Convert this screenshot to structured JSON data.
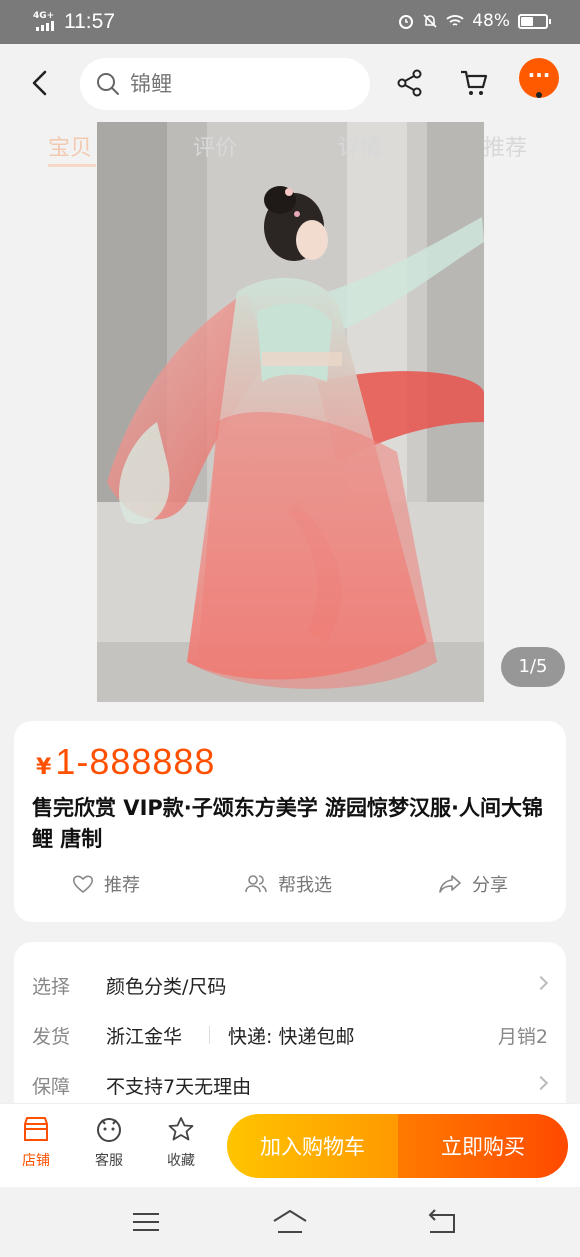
{
  "status_bar": {
    "network": "4G+",
    "time": "11:57",
    "battery": "48%",
    "battery_level": 0.48
  },
  "header": {
    "search_placeholder": "锦鲤"
  },
  "tabs": [
    "宝贝",
    "评价",
    "详情",
    "推荐"
  ],
  "gallery": {
    "indicator": "1/5"
  },
  "product": {
    "currency": "¥",
    "price": "1-888888",
    "title": "售完欣赏 VIP款·子颂东方美学 游园惊梦汉服·人间大锦鲤 唐制",
    "actions": [
      {
        "label": "推荐",
        "icon": "heart-icon"
      },
      {
        "label": "帮我选",
        "icon": "people-icon"
      },
      {
        "label": "分享",
        "icon": "share-arrow-icon"
      }
    ]
  },
  "specs": {
    "select": {
      "label": "选择",
      "value": "颜色分类/尺码"
    },
    "shipping": {
      "label": "发货",
      "origin": "浙江金华",
      "express": "快递: 快递包邮",
      "sales": "月销2"
    },
    "guarantee": {
      "label": "保障",
      "value": "不支持7天无理由"
    }
  },
  "bottom_bar": {
    "shop": "店铺",
    "service": "客服",
    "favorite": "收藏",
    "add_to_cart": "加入购物车",
    "buy_now": "立即购买"
  },
  "colors": {
    "accent": "#ff5000",
    "cart_button": "#ffb000",
    "buy_button": "#ff5a00"
  }
}
